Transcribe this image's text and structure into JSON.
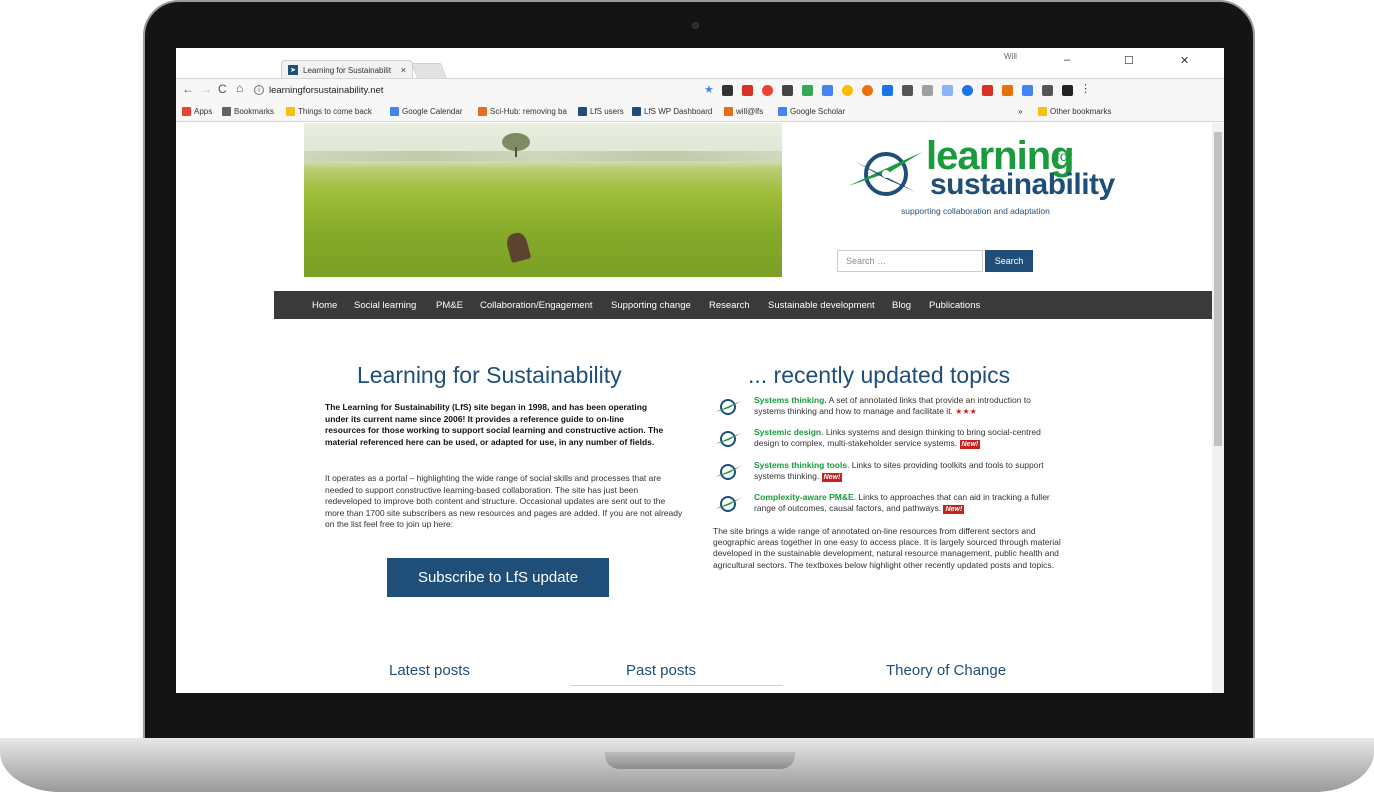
{
  "browser": {
    "tab_title": "Learning for Sustainabilit",
    "tab_close": "×",
    "profile_label": "Will",
    "url": "learningforsustainability.net",
    "window_controls": [
      "–",
      "☐",
      "✕"
    ],
    "bookmarks": [
      {
        "label": "Apps",
        "color": "#e94235"
      },
      {
        "label": "Bookmarks",
        "color": "#5f6368"
      },
      {
        "label": "Things to come back",
        "color": "#f4c20d"
      },
      {
        "label": "Google Calendar",
        "color": "#4285f4"
      },
      {
        "label": "Sci-Hub: removing ba",
        "color": "#e66c1e"
      },
      {
        "label": "LfS users",
        "color": "#1f4e79"
      },
      {
        "label": "LfS WP Dashboard",
        "color": "#1f4e79"
      },
      {
        "label": "will@lfs",
        "color": "#e66c1e"
      },
      {
        "label": "Google Scholar",
        "color": "#4285f4"
      }
    ],
    "bookmarks_overflow": "»",
    "other_bookmarks": "Other bookmarks"
  },
  "site": {
    "logo_word1": "learning",
    "logo_for": "for",
    "logo_word2": "sustainability",
    "logo_tagline": "supporting collaboration and adaptation",
    "search_placeholder": "Search …",
    "search_button": "Search",
    "nav": [
      "Home",
      "Social learning",
      "PM&E",
      "Collaboration/Engagement",
      "Supporting change",
      "Research",
      "Sustainable development",
      "Blog",
      "Publications"
    ]
  },
  "intro": {
    "title": "Learning for Sustainability",
    "bold_paragraph": "The Learning for Sustainability (LfS) site began in 1998, and has been operating under its current name since 2006! It provides a reference guide to on-line resources for those working to support social learning and constructive action. The material referenced here can be used, or adapted for use, in any number of fields.",
    "paragraph": "It operates as a portal – highlighting the wide range of social skills and processes that are needed to support constructive learning-based collaboration. The site has just been redeveloped to improve both content and structure.  Occasional updates are sent out to the more than 1700 site  subscribers as new resources and pages are added. If you are not already on the list feel free to join up here:",
    "subscribe_label": "Subscribe to LfS update"
  },
  "topics": {
    "title": "... recently updated topics",
    "items": [
      {
        "name": "Systems thinking.",
        "text": " A set of annotated links that provide an introduction to systems thinking and how to manage and facilitate it. ",
        "marker": "★★★"
      },
      {
        "name": "Systemic design",
        "text": ". Links systems and design thinking to bring social-centred design to complex, multi-stakeholder service systems. ",
        "marker": "New!"
      },
      {
        "name": "Systems thinking tools",
        "text": ". Links to sites providing toolkits and tools to support systems thinking. ",
        "marker": "New!"
      },
      {
        "name": "Complexity-aware PM&E",
        "text": ".  Links to approaches that can aid in tracking a fuller range of outcomes, causal factors, and pathways. ",
        "marker": "New!"
      }
    ],
    "paragraph": "The site brings a wide range of annotated on-line resources from different sectors and geographic areas together in one easy to access place. It is largely sourced through material developed in the sustainable development, natural resource management, public health and agricultural sectors. The textboxes below highlight other recently updated posts and topics."
  },
  "bottom": {
    "latest_posts": "Latest posts",
    "past_posts": "Past posts",
    "theory_of_change": "Theory of Change"
  },
  "colors": {
    "brand_blue": "#1f4e79",
    "brand_green": "#1a9b3b",
    "nav_bg": "#3a3a3a",
    "new_badge": "#c8221f"
  }
}
